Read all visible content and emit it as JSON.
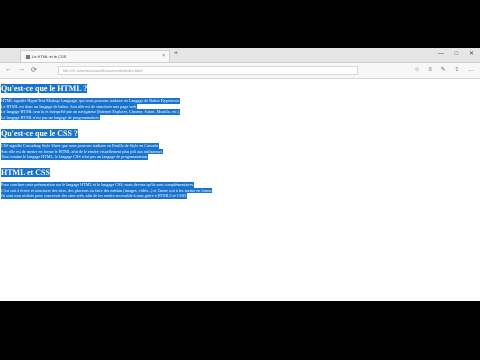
{
  "browser": {
    "tab_title": "Le HTML et le CSS",
    "tab_close": "×",
    "new_tab": "+",
    "window_controls": [
      "—",
      "□",
      "✕"
    ],
    "nav": {
      "back": "←",
      "forward": "→",
      "refresh": "⟳"
    },
    "address": "file:///C:/Users/dunord/Documents/index.html",
    "toolbar_icons": [
      "☆",
      "≡",
      "✎",
      "⇪",
      "…"
    ]
  },
  "page": {
    "heading1": "Qu'est-ce que le HTML ?",
    "para1": [
      "HTML signifie HyperText Markup Language, qui nous pouvons traduire en Langage de Balise Hypertexte.",
      "Le HTML est donc un langage de balise. Son rôle est de structurer une page web.",
      "Le langage HTML sera lu et interprété par un navigateur (Internet Explorer, Chrome, Safari, Mozilla, etc.).",
      "Le langage HTML n'est pas un langage de programmation."
    ],
    "heading2": "Qu'est-ce que le CSS ?",
    "para2": [
      "CSS signifie Cascading Style Sheet que nous pouvons traduire en Feuille de Style en Cascade.",
      "Son rôle est de mettre en forme le HTML afin de le rendre visuellement plus joli aux utilisateurs.",
      "Tout comme le langage HTML, le langage CSS n'est pas un langage de programmation."
    ],
    "heading3": "HTML et CSS",
    "para3": [
      "Pour conclure cette présentation sur le langage HTML et le langage CSS, nous devons qu'ils sont complémentaires.",
      "C'est soit à écrire et structurer des sites, des placeurs ou faire des médias (images, vidéo...) et l'autre soit à les mettre en forme.",
      "Ils sont tous utilisés pour concevoir des sites web, afin de les rendre accessible à tous grâce à HTML5 et CSS3."
    ]
  }
}
